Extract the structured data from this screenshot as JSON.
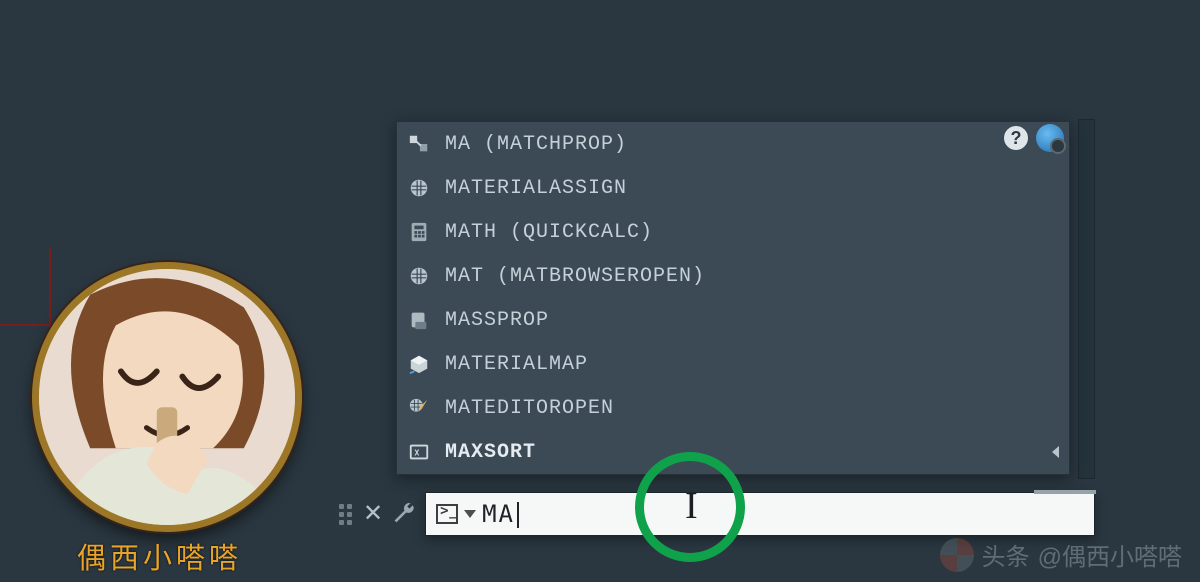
{
  "avatar": {
    "label": "偶西小嗒嗒"
  },
  "autocomplete": {
    "items": [
      {
        "icon": "matchprop-icon",
        "label": "MA (MATCHPROP)"
      },
      {
        "icon": "material-sphere-icon",
        "label": "MATERIALASSIGN"
      },
      {
        "icon": "calculator-icon",
        "label": "MATH (QUICKCALC)"
      },
      {
        "icon": "material-sphere-icon",
        "label": "MAT (MATBROWSEROPEN)"
      },
      {
        "icon": "massprop-icon",
        "label": "MASSPROP"
      },
      {
        "icon": "materialmap-icon",
        "label": "MATERIALMAP"
      },
      {
        "icon": "mateditor-icon",
        "label": "MATEDITOROPEN"
      }
    ],
    "sysvar": {
      "icon": "sysvar-icon",
      "label": "MAXSORT"
    }
  },
  "commandline": {
    "typed": "MA"
  },
  "watermark": {
    "prefix": "头条",
    "handle": "@偶西小嗒嗒"
  }
}
